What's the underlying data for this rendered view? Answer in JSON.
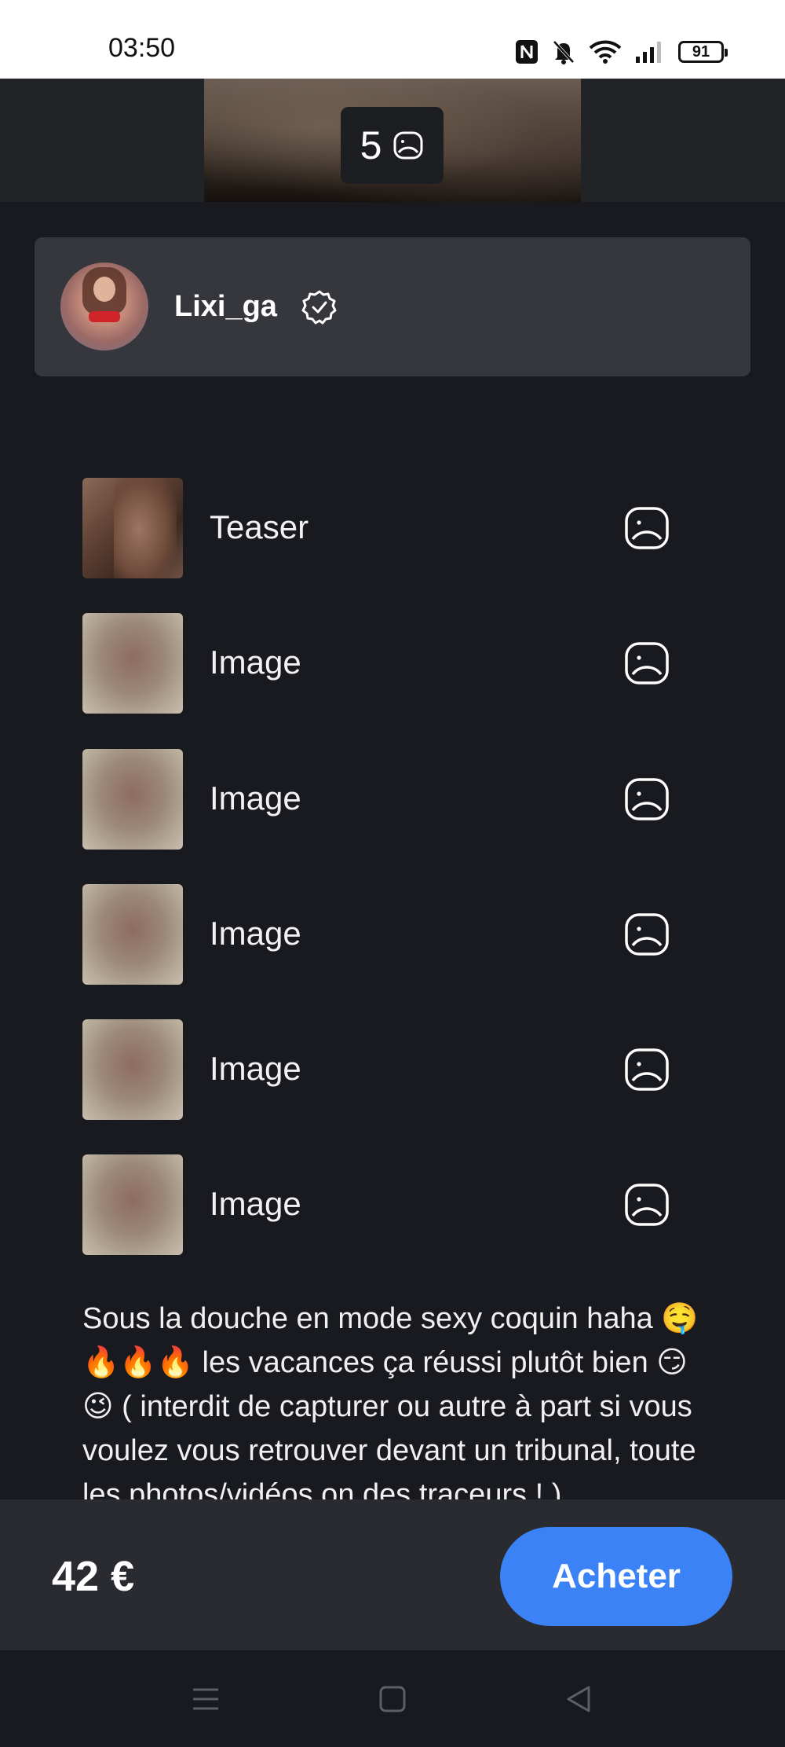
{
  "status_bar": {
    "time": "03:50",
    "battery": "91",
    "icons": [
      "nfc-icon",
      "bell-off-icon",
      "wifi-icon",
      "signal-icon",
      "battery-icon"
    ]
  },
  "media_header": {
    "count": "5",
    "count_icon": "sad-face-icon"
  },
  "creator": {
    "name": "Lixi_ga",
    "verified_icon": "verified-badge-icon"
  },
  "items": [
    {
      "label": "Teaser",
      "icon": "sad-face-icon",
      "blurred": false
    },
    {
      "label": "Image",
      "icon": "sad-face-icon",
      "blurred": true
    },
    {
      "label": "Image",
      "icon": "sad-face-icon",
      "blurred": true
    },
    {
      "label": "Image",
      "icon": "sad-face-icon",
      "blurred": true
    },
    {
      "label": "Image",
      "icon": "sad-face-icon",
      "blurred": true
    },
    {
      "label": "Image",
      "icon": "sad-face-icon",
      "blurred": true
    }
  ],
  "description": "Sous la douche en mode sexy coquin haha 🤤🔥🔥🔥 les vacances ça réussi plutôt bien 😏😉 ( interdit de capturer ou autre à part si vous voulez vous retrouver devant un tribunal, toute les photos/vidéos on des traceurs ! )",
  "purchase": {
    "price": "42 €",
    "buy_label": "Acheter"
  },
  "colors": {
    "background": "#191a1f",
    "card": "#36373c",
    "accent": "#3b82f6",
    "bottom_bar": "#2a2b30"
  },
  "nav": [
    "menu-icon",
    "home-icon",
    "back-icon"
  ]
}
